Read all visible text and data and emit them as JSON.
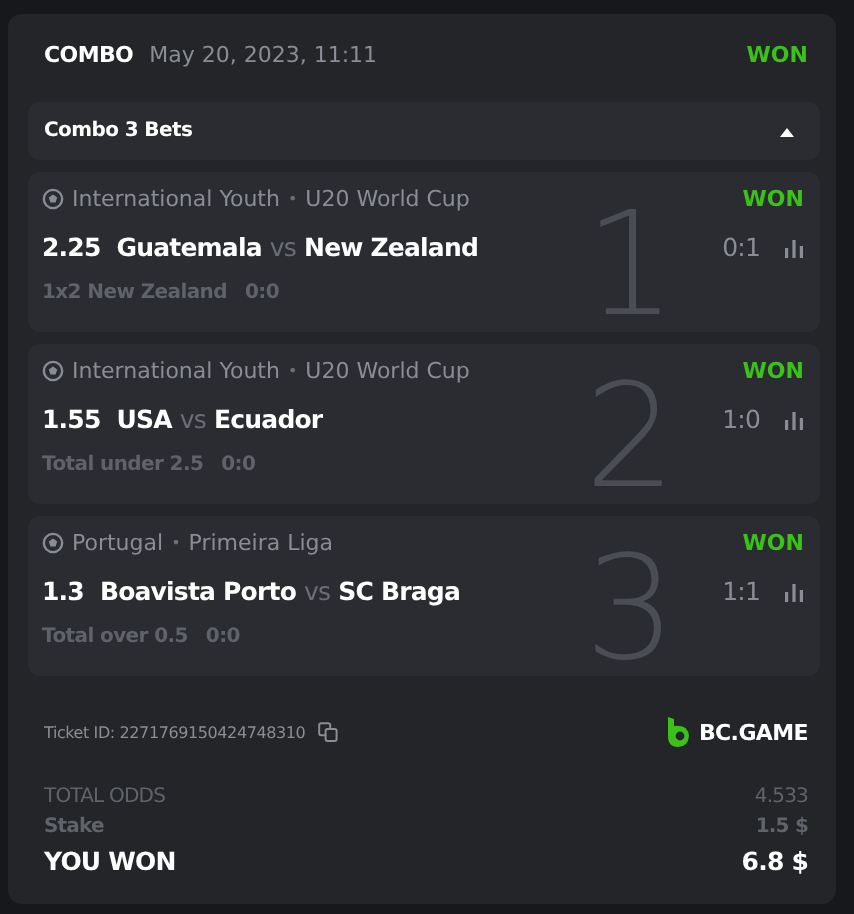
{
  "header": {
    "type": "COMBO",
    "date": "May 20, 2023, 11:11",
    "status": "WON"
  },
  "combo_bar": {
    "label": "Combo 3 Bets",
    "expanded": true
  },
  "bets": [
    {
      "index": "1",
      "league": "International Youth",
      "separator": "•",
      "tournament": "U20 World Cup",
      "status": "WON",
      "odds": "2.25",
      "home": "Guatemala",
      "vs": "vs",
      "away": "New Zealand",
      "score": "0:1",
      "market": "1x2 New Zealand",
      "market_score": "0:0"
    },
    {
      "index": "2",
      "league": "International Youth",
      "separator": "•",
      "tournament": "U20 World Cup",
      "status": "WON",
      "odds": "1.55",
      "home": "USA",
      "vs": "vs",
      "away": "Ecuador",
      "score": "1:0",
      "market": "Total under 2.5",
      "market_score": "0:0"
    },
    {
      "index": "3",
      "league": "Portugal",
      "separator": "•",
      "tournament": "Primeira Liga",
      "status": "WON",
      "odds": "1.3",
      "home": "Boavista Porto",
      "vs": "vs",
      "away": "SC Braga",
      "score": "1:1",
      "market": "Total over 0.5",
      "market_score": "0:0"
    }
  ],
  "ticket": {
    "label": "Ticket ID: 2271769150424748310",
    "brand": "BC.GAME"
  },
  "summary": [
    {
      "kind": "odds",
      "label": "TOTAL ODDS",
      "value": "4.533"
    },
    {
      "kind": "stake",
      "label": "Stake",
      "value": "1.5 $"
    },
    {
      "kind": "won",
      "label": "YOU WON",
      "value": "6.8 $"
    }
  ]
}
